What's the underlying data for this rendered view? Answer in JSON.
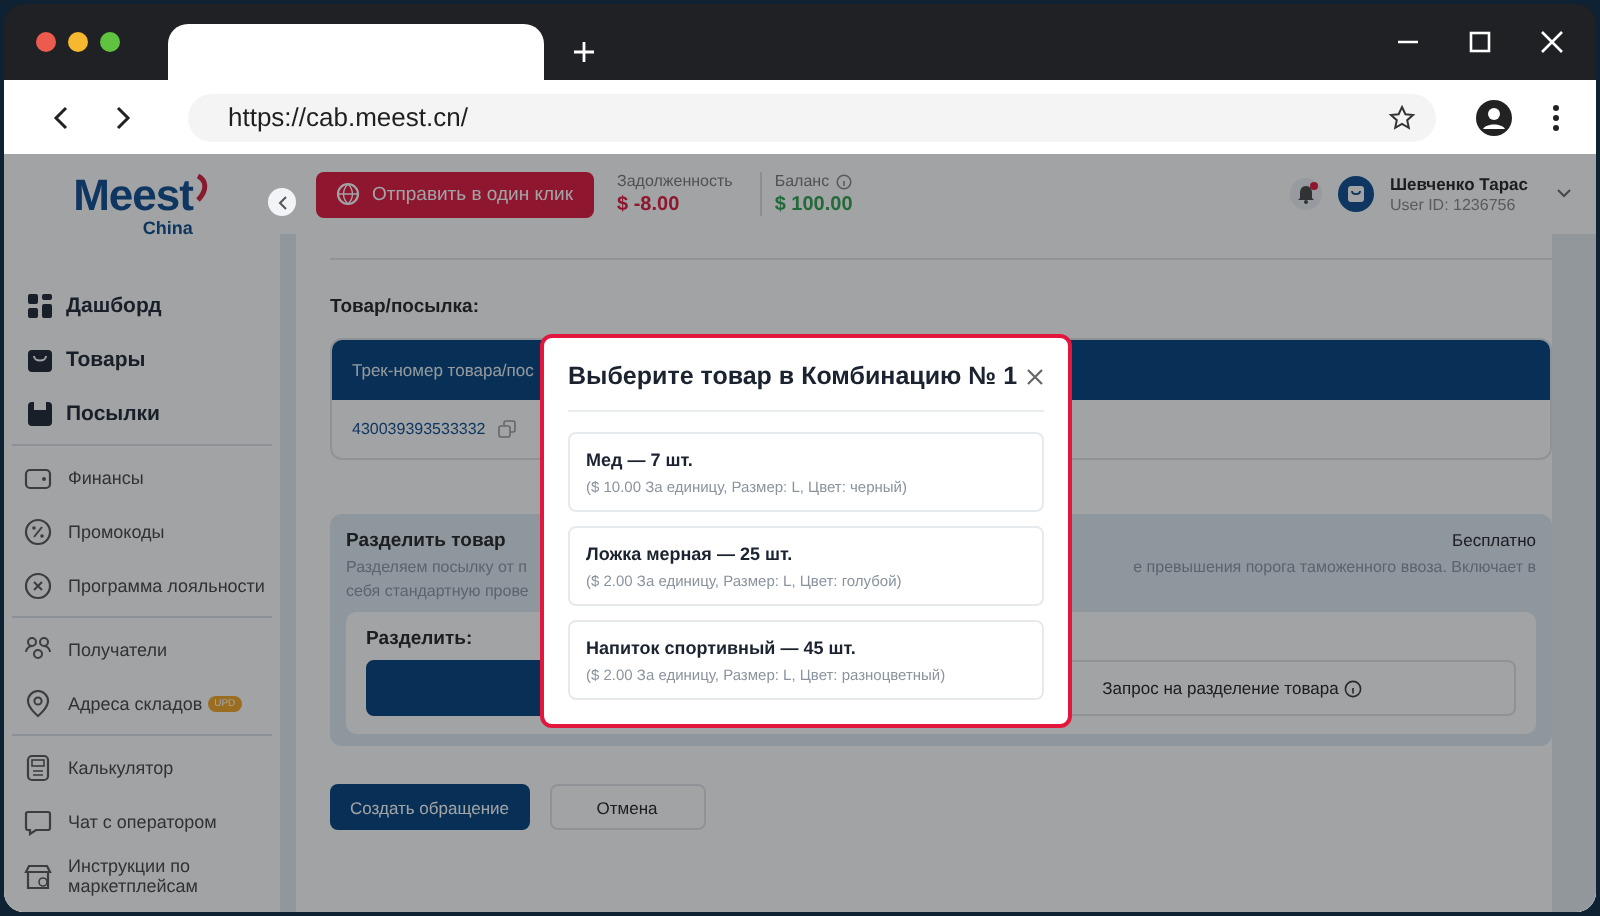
{
  "browser": {
    "address": "https://cab.meest.cn/"
  },
  "sidebar": {
    "logo": {
      "brand": "Meest",
      "region": "China"
    },
    "groups": [
      {
        "kind": "main",
        "items": [
          {
            "label": "Дашборд"
          },
          {
            "label": "Товары"
          },
          {
            "label": "Посылки"
          }
        ]
      },
      {
        "kind": "secondary",
        "items": [
          {
            "label": "Финансы"
          },
          {
            "label": "Промокоды"
          },
          {
            "label": "Программа лояльности"
          }
        ]
      },
      {
        "kind": "secondary",
        "items": [
          {
            "label": "Получатели"
          },
          {
            "label": "Адреса складов",
            "badge": "UPD"
          }
        ]
      },
      {
        "kind": "secondary",
        "items": [
          {
            "label": "Калькулятор"
          },
          {
            "label": "Чат с оператором"
          },
          {
            "label": "Инструкции по маркетплейсам"
          }
        ]
      }
    ]
  },
  "topbar": {
    "send_button": "Отправить в один клик",
    "debt": {
      "label": "Задолженность",
      "value": "$ -8.00"
    },
    "balance": {
      "label": "Баланс",
      "value": "$ 100.00"
    },
    "notifications": {
      "unread": true
    },
    "user": {
      "name": "Шевченко Тарас",
      "user_id": "User ID: 1236756"
    }
  },
  "main": {
    "section_label": "Товар/посылка:",
    "table": {
      "columns": [
        "Трек-номер товара/пос"
      ],
      "rows": [
        [
          "430039393533332"
        ]
      ]
    },
    "split": {
      "title": "Разделить товар",
      "price": "Бесплатно",
      "description": [
        [
          "Разделяем посылку от п",
          "е превышения порога таможенного ввоза. Включает в"
        ],
        [
          "себя стандартную прове"
        ]
      ],
      "label": "Разделить:",
      "options": [
        {
          "selected": true
        },
        {
          "label": "Запрос на разделение товара",
          "selected": false
        }
      ]
    },
    "actions": [
      {
        "kind": "primary",
        "label": "Создать обращение"
      },
      {
        "kind": "secondary",
        "label": "Отмена"
      }
    ]
  },
  "modal": {
    "title": "Выберите товар в Комбинацию № 1",
    "items": [
      {
        "name": "Мед — 7 шт.",
        "details": "($ 10.00 За единицу, Размер: L, Цвет: черный)"
      },
      {
        "name": "Ложка мерная — 25 шт.",
        "details": "($ 2.00 За единицу, Размер: L, Цвет: голубой)"
      },
      {
        "name": "Напиток спортивный — 45 шт.",
        "details": "($ 2.00 За единицу, Размер: L, Цвет: разноцветный)"
      }
    ]
  }
}
